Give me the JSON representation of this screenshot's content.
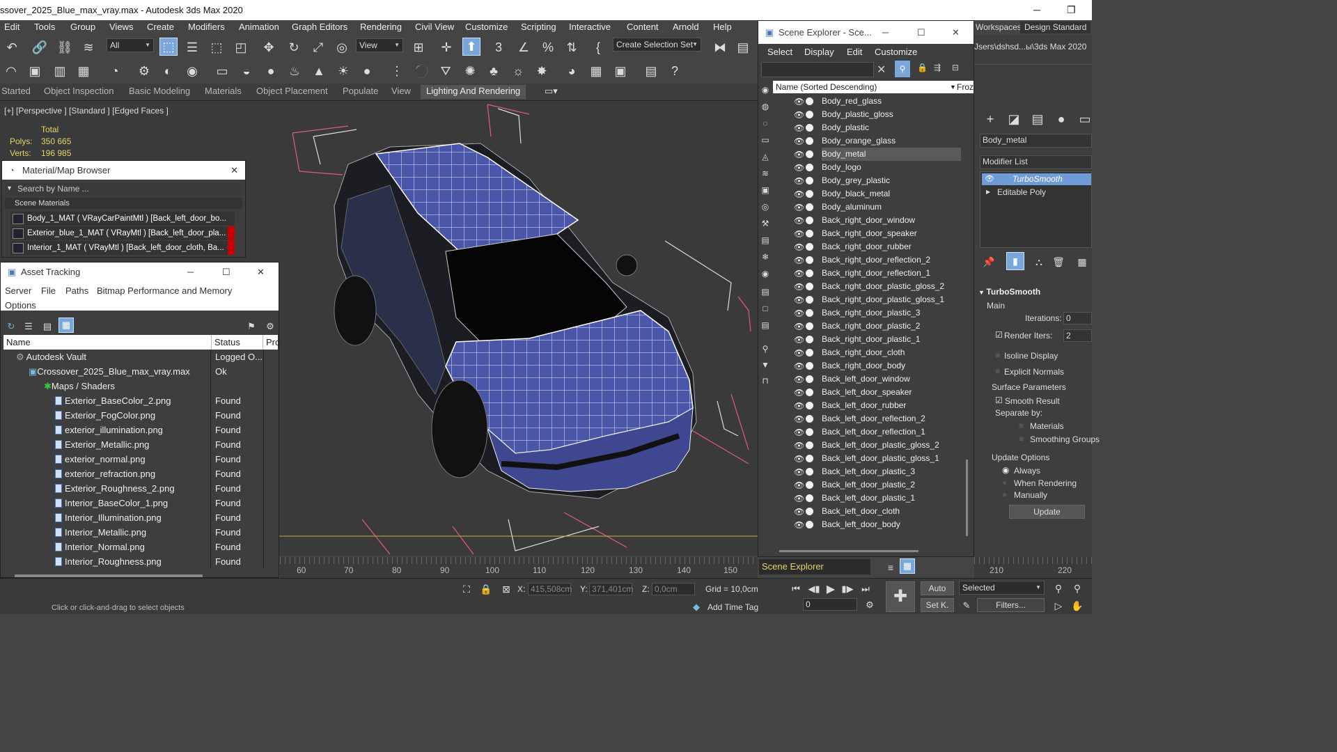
{
  "window": {
    "title": "ssover_2025_Blue_max_vray.max - Autodesk 3ds Max 2020",
    "minimize": "─",
    "restore": "❐"
  },
  "menu": [
    "Edit",
    "Tools",
    "Group",
    "Views",
    "Create",
    "Modifiers",
    "Animation",
    "Graph Editors",
    "Rendering",
    "Civil View",
    "Customize",
    "Scripting",
    "Interactive",
    "Content",
    "Arnold",
    "Help"
  ],
  "toolbar": {
    "selection_filter": "All",
    "ref_coord": "View",
    "selection_set": "Create Selection Set"
  },
  "ribbon": {
    "tabs": [
      "Started",
      "Object Inspection",
      "Basic Modeling",
      "Materials",
      "Object Placement",
      "Populate",
      "View",
      "Lighting And Rendering"
    ]
  },
  "viewport": {
    "label": "[+] [Perspective ] [Standard ] [Edged Faces ]",
    "stats": {
      "total_label": "Total",
      "polys_label": "Polys:",
      "polys": "350 665",
      "verts_label": "Verts:",
      "verts": "196 985"
    }
  },
  "material_browser": {
    "title": "Material/Map Browser",
    "search_placeholder": "Search by Name ...",
    "group": "Scene Materials",
    "items": [
      "Body_1_MAT  ( VRayCarPaintMtl )  [Back_left_door_bo...",
      "Exterior_blue_1_MAT  ( VRayMtl )  [Back_left_door_pla...",
      "Interior_1_MAT  ( VRayMtl )  [Back_left_door_cloth, Ba..."
    ],
    "close": "✕"
  },
  "asset_tracking": {
    "title": "Asset Tracking",
    "menu": [
      "Server",
      "File",
      "Paths",
      "Bitmap Performance and Memory",
      "Options"
    ],
    "columns": [
      "Name",
      "Status",
      "Pro"
    ],
    "rows": [
      {
        "name": "Autodesk Vault",
        "status": "Logged O..."
      },
      {
        "name": "Crossover_2025_Blue_max_vray.max",
        "status": "Ok"
      },
      {
        "name": "Maps / Shaders",
        "status": ""
      },
      {
        "name": "Exterior_BaseColor_2.png",
        "status": "Found"
      },
      {
        "name": "Exterior_FogColor.png",
        "status": "Found"
      },
      {
        "name": "exterior_illumination.png",
        "status": "Found"
      },
      {
        "name": "Exterior_Metallic.png",
        "status": "Found"
      },
      {
        "name": "exterior_normal.png",
        "status": "Found"
      },
      {
        "name": "exterior_refraction.png",
        "status": "Found"
      },
      {
        "name": "Exterior_Roughness_2.png",
        "status": "Found"
      },
      {
        "name": "Interior_BaseColor_1.png",
        "status": "Found"
      },
      {
        "name": "Interior_Illumination.png",
        "status": "Found"
      },
      {
        "name": "Interior_Metallic.png",
        "status": "Found"
      },
      {
        "name": "Interior_Normal.png",
        "status": "Found"
      },
      {
        "name": "Interior_Roughness.png",
        "status": "Found"
      }
    ],
    "minimize": "─",
    "maximize": "☐",
    "close": "✕"
  },
  "scene_explorer": {
    "title": "Scene Explorer - Sce...",
    "menu": [
      "Select",
      "Display",
      "Edit",
      "Customize"
    ],
    "column": "Name (Sorted Descending)",
    "frozen": "Froze",
    "footer": "Scene Explorer",
    "items": [
      "Body_red_glass",
      "Body_plastic_gloss",
      "Body_plastic",
      "Body_orange_glass",
      "Body_metal",
      "Body_logo",
      "Body_grey_plastic",
      "Body_black_metal",
      "Body_aluminum",
      "Back_right_door_window",
      "Back_right_door_speaker",
      "Back_right_door_rubber",
      "Back_right_door_reflection_2",
      "Back_right_door_reflection_1",
      "Back_right_door_plastic_gloss_2",
      "Back_right_door_plastic_gloss_1",
      "Back_right_door_plastic_3",
      "Back_right_door_plastic_2",
      "Back_right_door_plastic_1",
      "Back_right_door_cloth",
      "Back_right_door_body",
      "Back_left_door_window",
      "Back_left_door_speaker",
      "Back_left_door_rubber",
      "Back_left_door_reflection_2",
      "Back_left_door_reflection_1",
      "Back_left_door_plastic_gloss_2",
      "Back_left_door_plastic_gloss_1",
      "Back_left_door_plastic_3",
      "Back_left_door_plastic_2",
      "Back_left_door_plastic_1",
      "Back_left_door_cloth",
      "Back_left_door_body"
    ],
    "selected": "Body_metal",
    "minimize": "─",
    "maximize": "☐",
    "close": "✕"
  },
  "command_panel": {
    "workspaces_label": "Workspaces:",
    "workspace": "Design Standard",
    "path": "Jsers\\dshsd...ы\\3ds Max 2020",
    "object_name": "Body_metal",
    "modifier_list": "Modifier List",
    "stack": [
      "TurboSmooth",
      "Editable Poly"
    ],
    "turbosmooth": {
      "title": "TurboSmooth",
      "main": "Main",
      "iterations_label": "Iterations:",
      "iterations": "0",
      "render_iters_label": "Render Iters:",
      "render_iters": "2",
      "isoline": "Isoline Display",
      "explicit": "Explicit Normals",
      "surface": "Surface Parameters",
      "smooth_result": "Smooth Result",
      "separate": "Separate by:",
      "materials": "Materials",
      "smoothing": "Smoothing Groups",
      "update_options": "Update Options",
      "always": "Always",
      "when_rendering": "When Rendering",
      "manually": "Manually",
      "update": "Update"
    }
  },
  "timeline": {
    "ticks": [
      "60",
      "70",
      "80",
      "90",
      "100",
      "110",
      "120",
      "130",
      "140",
      "150",
      "210",
      "220"
    ]
  },
  "status": {
    "x_label": "X:",
    "x": "415,508cm",
    "y_label": "Y:",
    "y": "371,401cm",
    "z_label": "Z:",
    "z": "0,0cm",
    "grid": "Grid = 10,0cm",
    "add_time_tag": "Add Time Tag",
    "prompt": "Click or click-and-drag to select objects",
    "auto": "Auto",
    "setk": "Set K.",
    "selected": "Selected",
    "frame": "0",
    "filters": "Filters..."
  }
}
